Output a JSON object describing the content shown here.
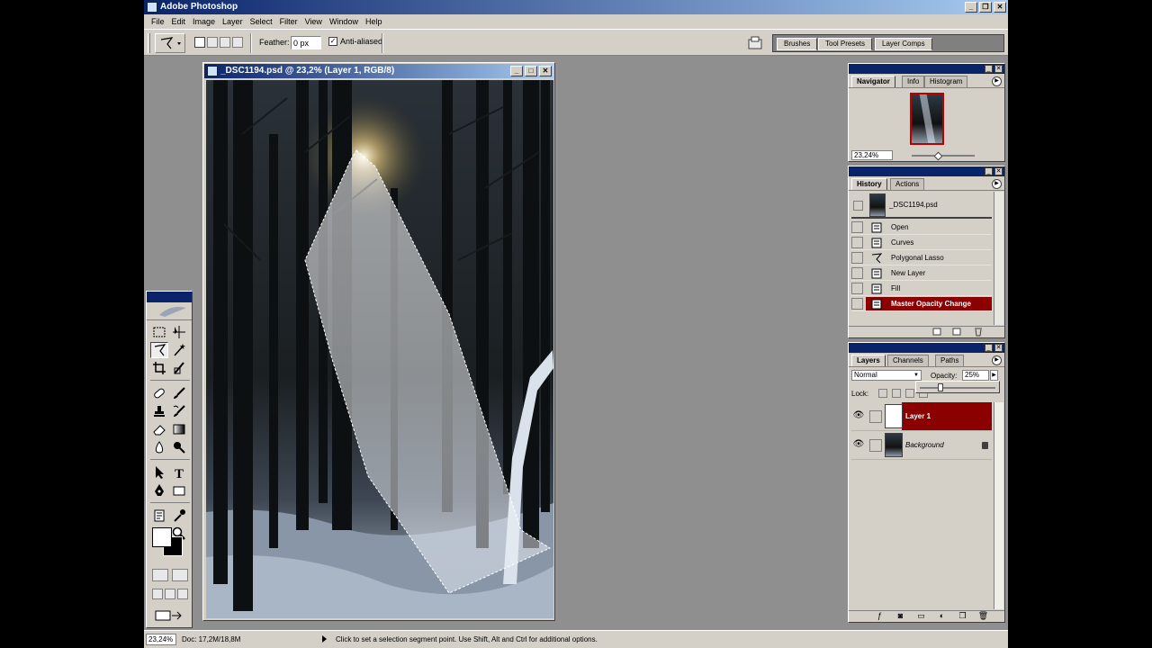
{
  "app": {
    "title": "Adobe Photoshop"
  },
  "menu": [
    "File",
    "Edit",
    "Image",
    "Layer",
    "Select",
    "Filter",
    "View",
    "Window",
    "Help"
  ],
  "options": {
    "feather_label": "Feather:",
    "feather_value": "0 px",
    "antialias_label": "Anti-aliased",
    "antialias_checked": "✓"
  },
  "palette_well": {
    "tabs": [
      "Brushes",
      "Tool Presets",
      "Layer Comps"
    ]
  },
  "document": {
    "title": "_DSC1194.psd @ 23,2% (Layer 1, RGB/8)"
  },
  "navigator": {
    "tabs": [
      "Navigator",
      "Info",
      "Histogram"
    ],
    "zoom": "23,24%"
  },
  "history": {
    "tabs": [
      "History",
      "Actions"
    ],
    "snapshot": "_DSC1194.psd",
    "states": [
      {
        "label": "Open",
        "icon": "document-icon"
      },
      {
        "label": "Curves",
        "icon": "document-icon"
      },
      {
        "label": "Polygonal Lasso",
        "icon": "polygonal-lasso-icon"
      },
      {
        "label": "New Layer",
        "icon": "document-icon"
      },
      {
        "label": "Fill",
        "icon": "document-icon"
      },
      {
        "label": "Master Opacity Change",
        "icon": "document-icon",
        "active": true
      }
    ]
  },
  "layers_panel": {
    "tabs": [
      "Layers",
      "Channels",
      "Paths"
    ],
    "blend_mode": "Normal",
    "opacity_label": "Opacity:",
    "opacity_value": "25%",
    "opacity_fraction": 0.25,
    "lock_label": "Lock:",
    "layers": [
      {
        "name": "Layer 1",
        "active": true,
        "visible": true
      },
      {
        "name": "Background",
        "active": false,
        "visible": true,
        "locked": true
      }
    ]
  },
  "status": {
    "zoom": "23,24%",
    "doc_size": "Doc: 17,2M/18,8M",
    "hint": "Click to set a selection segment point.  Use Shift, Alt and Ctrl for additional options."
  },
  "colors": {
    "title_start": "#0a246a",
    "title_end": "#a6caf0",
    "chrome": "#d4d0c8",
    "workspace": "#8f8f8f",
    "active_layer": "#8b0000"
  }
}
